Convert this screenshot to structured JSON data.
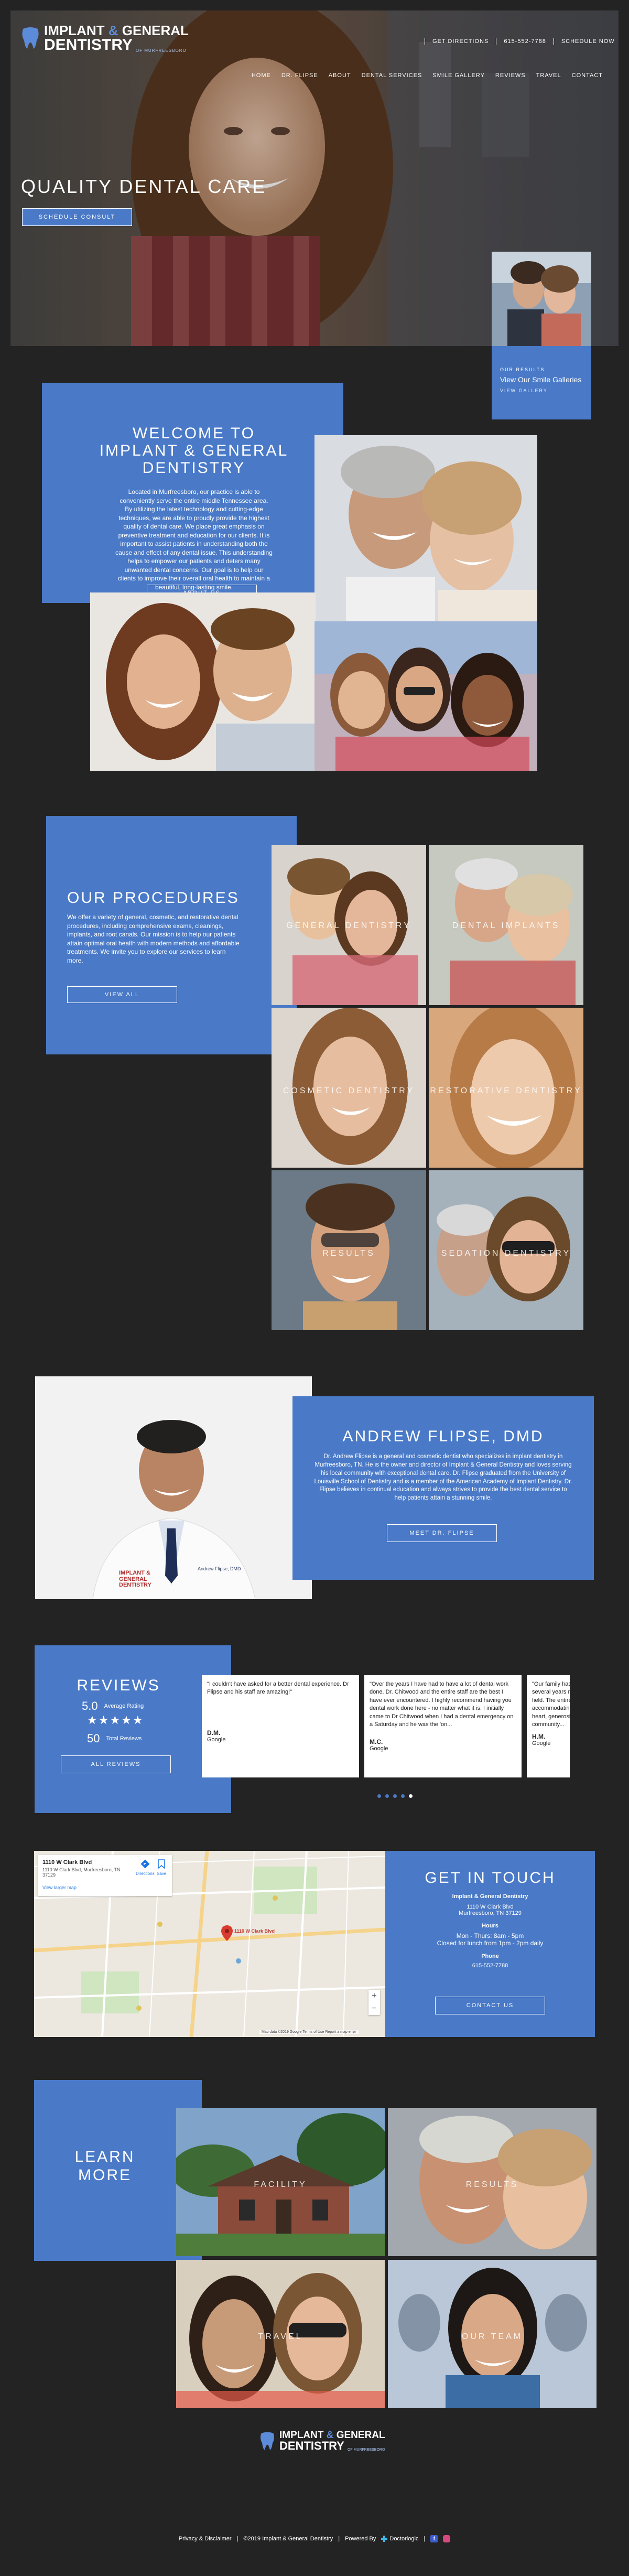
{
  "brand": {
    "name_line1": "IMPLANT",
    "name_amp": "&",
    "name_line1b": "GENERAL",
    "name_line2": "DENTISTRY",
    "tagline": "OF MURFREESBORO"
  },
  "topbar": {
    "directions": "GET DIRECTIONS",
    "phone": "615-552-7788",
    "schedule": "SCHEDULE NOW"
  },
  "nav": [
    "HOME",
    "DR. FLIPSE",
    "ABOUT",
    "DENTAL SERVICES",
    "SMILE GALLERY",
    "REVIEWS",
    "TRAVEL",
    "CONTACT"
  ],
  "hero": {
    "headline": "QUALITY DENTAL CARE",
    "cta": "SCHEDULE CONSULT"
  },
  "smile_card": {
    "kicker": "OUR RESULTS",
    "title": "View Our Smile Galleries",
    "link": "VIEW GALLERY"
  },
  "welcome": {
    "title": "WELCOME TO IMPLANT & GENERAL DENTISTRY",
    "body": "Located in Murfreesboro, our practice is able to conveniently serve the entire middle Tennessee area. By utilizing the latest technology and cutting-edge techniques, we are able to proudly provide the highest quality of dental care. We place great emphasis on preventive treatment and education for our clients. It is important to assist patients in understanding both the cause and effect of any dental issue. This understanding helps to empower our patients and deters many unwanted dental concerns. Our goal is to help our clients to improve their overall oral health to maintain a beautiful, long-lasting smile.",
    "button": "ABOUT US"
  },
  "procedures": {
    "title": "OUR PROCEDURES",
    "body": "We offer a variety of general, cosmetic, and restorative dental procedures, including comprehensive exams, cleanings, implants, and root canals. Our mission is to help our patients attain optimal oral health with modern methods and affordable treatments. We invite you to explore our services to learn more.",
    "button": "VIEW ALL",
    "tiles": [
      "GENERAL DENTISTRY",
      "DENTAL IMPLANTS",
      "COSMETIC DENTISTRY",
      "RESTORATIVE DENTISTRY",
      "RESULTS",
      "SEDATION DENTISTRY"
    ]
  },
  "doctor": {
    "title": "ANDREW FLIPSE, DMD",
    "body": "Dr. Andrew Flipse is a general and cosmetic dentist who specializes in implant dentistry in Murfreesboro, TN. He is the owner and director of Implant & General Dentistry and loves serving his local community with exceptional dental care. Dr. Flipse graduated from the University of Louisville School of Dentistry and is a member of the American Academy of Implant Dentistry. Dr. Flipse believes in continual education and always strives to provide the best dental service to help patients attain a stunning smile.",
    "button": "MEET DR. FLIPSE",
    "coat_name": "Andrew Flipse, DMD",
    "logo_text": "IMPLANT & GENERAL DENTISTRY"
  },
  "reviews": {
    "title": "REVIEWS",
    "rating": "5.0",
    "rating_label": "Average Rating",
    "stars": "★★★★★",
    "count": "50",
    "count_label": "Total Reviews",
    "button": "ALL REVIEWS",
    "items": [
      {
        "text": "\"I couldn't have asked for a better dental experience. Dr Flipse and his staff are amazing!\"",
        "name": "D.M.",
        "source": "Google"
      },
      {
        "text": "\"Over the years I have had to have a lot of dental work done. Dr. Chitwood and the entire staff are the best I have ever encountered. I highly recommend having you dental work done here - no matter what it is. I initially came to Dr Chitwood when I had a dental emergency on a Saturday and he was the 'on...",
        "name": "M.C.",
        "source": "Google"
      },
      {
        "text": "\"Our family has used Implant & General Dentistry for several years now. Dr. Chitwood are leaders in their field. The entire staff is professional, thorough and accommodating. We are so thankful to their caring heart, generosity and to be involved in local community...",
        "name": "H.M.",
        "source": "Google"
      }
    ]
  },
  "contact": {
    "title": "GET IN TOUCH",
    "business": "Implant & General Dentistry",
    "address1": "1110 W Clark Blvd",
    "address2": "Murfreesboro, TN 37129",
    "hours_label": "Hours",
    "hours1": "Mon - Thurs: 8am - 5pm",
    "hours2": "Closed for lunch from 1pm - 2pm daily",
    "phone_label": "Phone",
    "phone": "615-552-7788",
    "button": "CONTACT US",
    "map_title": "1110 W Clark Blvd",
    "map_addr": "1110 W Clark Blvd, Murfreesboro, TN 37129",
    "map_larger": "View larger map",
    "map_directions": "Directions",
    "map_save": "Save",
    "map_pin_label": "1110 W Clark Blvd",
    "map_footer": "Map data ©2019 Google  Terms of Use  Report a map error"
  },
  "learn": {
    "title": "LEARN MORE",
    "tiles": [
      "FACILITY",
      "RESULTS",
      "TRAVEL",
      "OUR TEAM"
    ]
  },
  "footer": {
    "privacy": "Privacy & Disclaimer",
    "copyright": "©2019 Implant & General Dentistry",
    "powered": "Powered By",
    "powered_brand": "Doctorlogic"
  },
  "colors": {
    "accent": "#4a7ac7",
    "bg": "#232323"
  }
}
